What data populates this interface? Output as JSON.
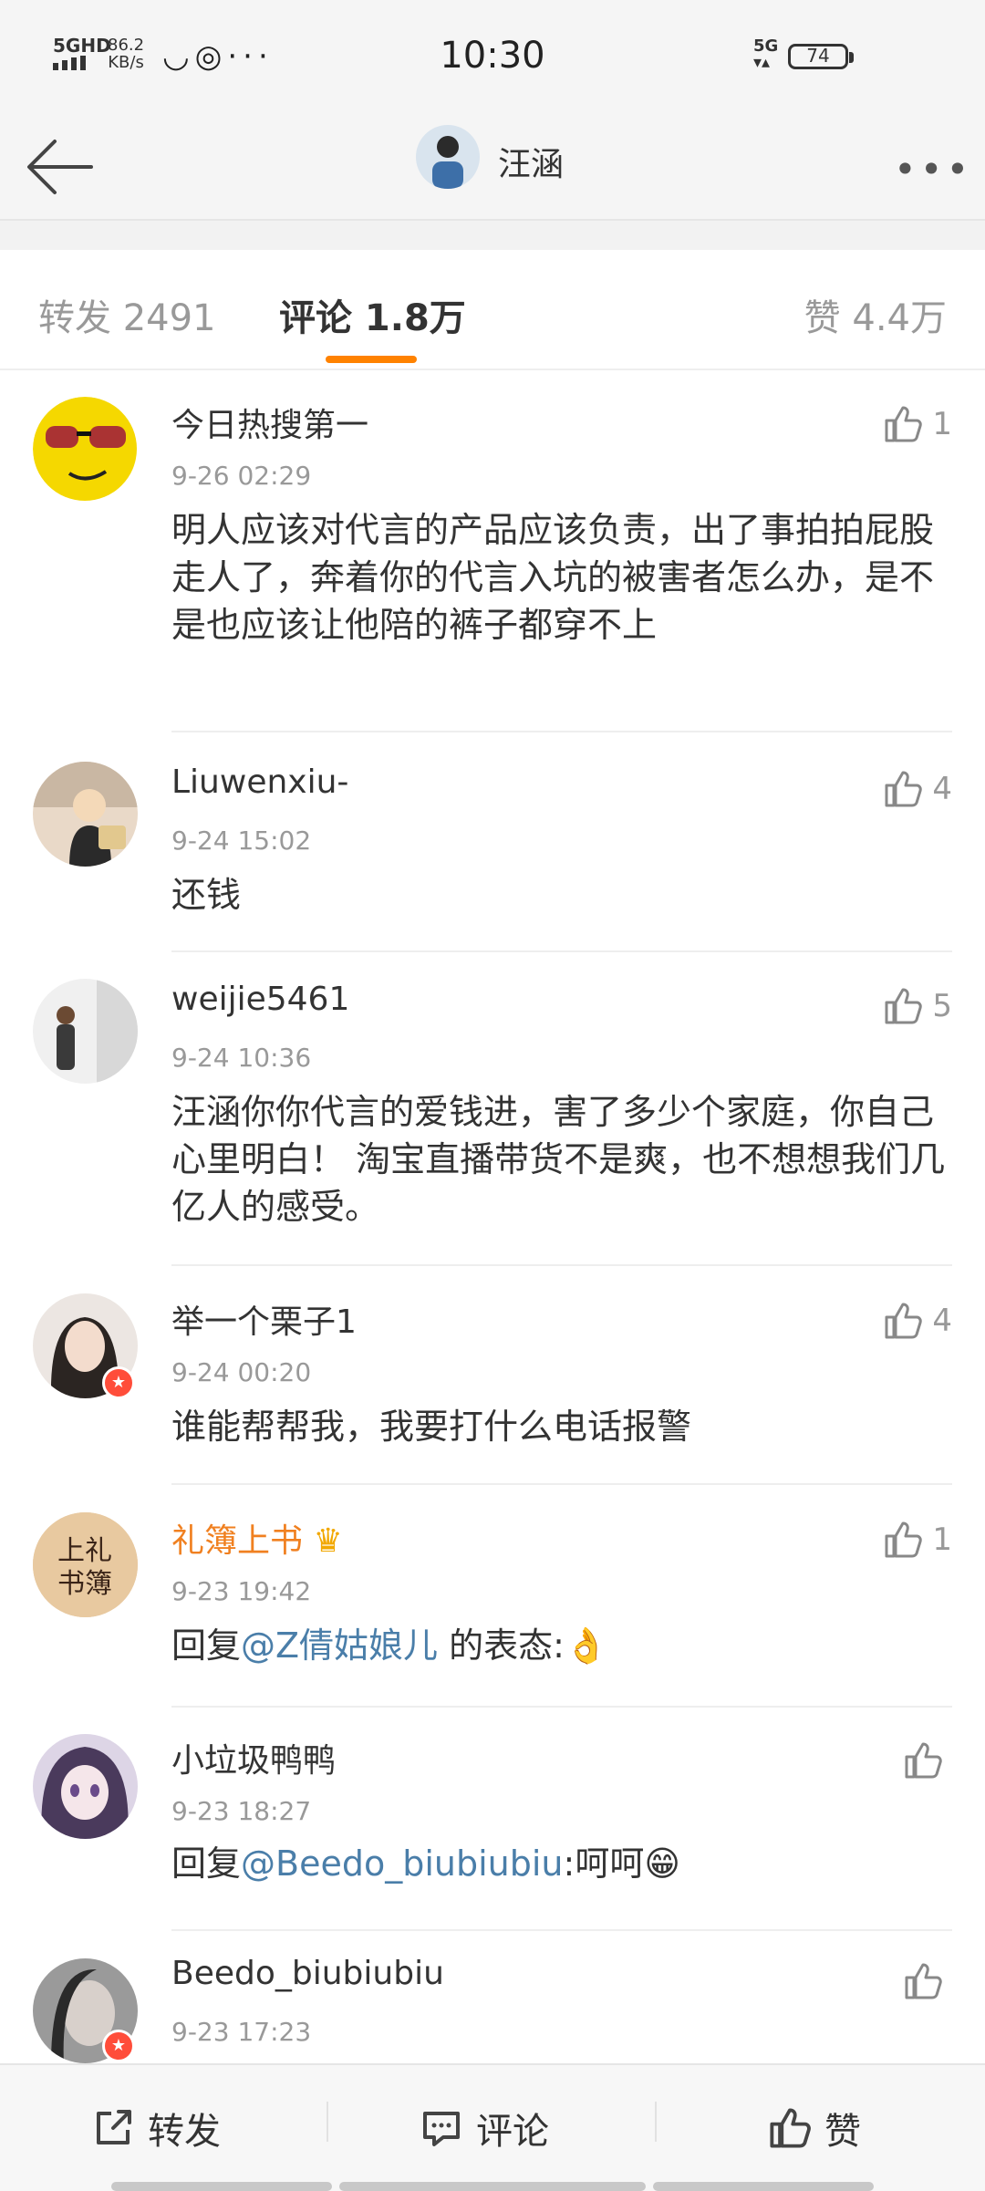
{
  "status": {
    "network": "5GHD",
    "speed_value": "86.2",
    "speed_unit": "KB/s",
    "time": "10:30",
    "cell": "5G",
    "battery": "74"
  },
  "header": {
    "title": "汪涵"
  },
  "tabs": [
    {
      "label": "转发 2491",
      "active": false
    },
    {
      "label": "评论 1.8万",
      "active": true
    },
    {
      "label": "赞 4.4万",
      "active": false
    }
  ],
  "comments": [
    {
      "user": "今日热搜第一",
      "time": "9-26 02:29",
      "likes": "1",
      "text": "明人应该对代言的产品应该负责，出了事拍拍屁股走人了，奔着你的代言入坑的被害者怎么办，是不是也应该让他陪的裤子都穿不上"
    },
    {
      "user": "Liuwenxiu-",
      "time": "9-24 15:02",
      "likes": "4",
      "text": "还钱"
    },
    {
      "user": "weijie5461",
      "time": "9-24 10:36",
      "likes": "5",
      "text": "汪涵你你代言的爱钱进，害了多少个家庭，你自己心里明白！ 淘宝直播带货不是爽，也不想想我们几亿人的感受。"
    },
    {
      "user": "举一个栗子1",
      "time": "9-24 00:20",
      "likes": "4",
      "text": "谁能帮帮我，我要打什么电话报警"
    },
    {
      "user": "礼簿上书",
      "time": "9-23 19:42",
      "likes": "1",
      "reply_prefix": "回复",
      "mention": "@Z倩姑娘儿",
      "reply_suffix": " 的表态:",
      "emoji": "👌",
      "avatar_text": "上礼书簿"
    },
    {
      "user": "小垃圾鸭鸭",
      "time": "9-23 18:27",
      "likes": "",
      "reply_prefix": "回复",
      "mention": "@Beedo_biubiubiu",
      "reply_suffix": ":呵呵",
      "emoji": "😁"
    },
    {
      "user": "Beedo_biubiubiu",
      "time": "9-23 17:23",
      "likes": ""
    }
  ],
  "bottom": {
    "repost": "转发",
    "comment": "评论",
    "like": "赞"
  },
  "colors": {
    "accent": "#ff8200",
    "mention": "#4a7ea9",
    "vip_name": "#f08020"
  }
}
